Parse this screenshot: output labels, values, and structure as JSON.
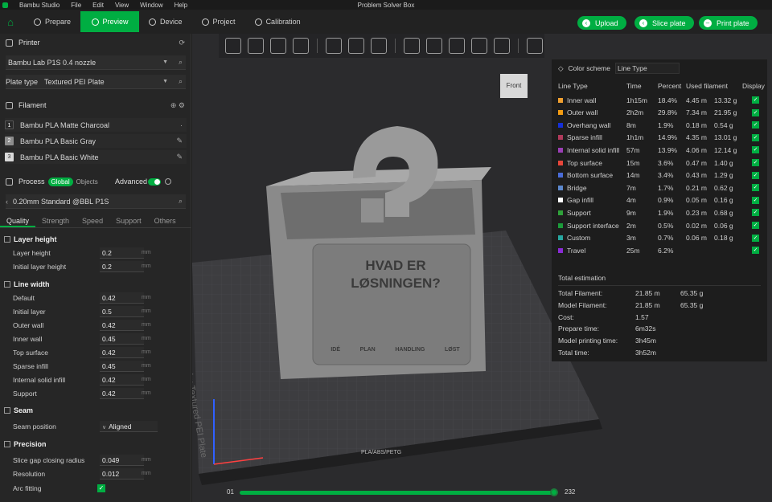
{
  "app": {
    "name": "Bambu Studio",
    "window_title": "Problem Solver Box",
    "menu": [
      "File",
      "Edit",
      "View",
      "Window",
      "Help"
    ]
  },
  "toolbar": {
    "tabs": [
      "Prepare",
      "Preview",
      "Device",
      "Project",
      "Calibration"
    ],
    "active_tab": "Preview",
    "actions": [
      "Upload",
      "Slice plate",
      "Print plate"
    ]
  },
  "printer": {
    "section": "Printer",
    "name": "Bambu Lab P1S 0.4 nozzle",
    "plate_label": "Plate type",
    "plate_value": "Textured PEI Plate"
  },
  "filament": {
    "section": "Filament",
    "items": [
      {
        "num": "1",
        "name": "Bambu PLA Matte Charcoal",
        "color": "#2a2a2a"
      },
      {
        "num": "2",
        "name": "Bambu PLA Basic Gray",
        "color": "#8c8c8c"
      },
      {
        "num": "3",
        "name": "Bambu PLA Basic White",
        "color": "#d9d9d9"
      }
    ]
  },
  "process": {
    "section": "Process",
    "global": "Global",
    "objects": "Objects",
    "advanced": "Advanced",
    "advanced_on": true,
    "preset": "0.20mm Standard @BBL P1S",
    "tabs": [
      "Quality",
      "Strength",
      "Speed",
      "Support",
      "Others"
    ],
    "active": "Quality"
  },
  "settings": {
    "layer_height": {
      "title": "Layer height",
      "params": [
        {
          "label": "Layer height",
          "value": "0.2",
          "unit": "mm"
        },
        {
          "label": "Initial layer height",
          "value": "0.2",
          "unit": "mm"
        }
      ]
    },
    "line_width": {
      "title": "Line width",
      "params": [
        {
          "label": "Default",
          "value": "0.42",
          "unit": "mm"
        },
        {
          "label": "Initial layer",
          "value": "0.5",
          "unit": "mm"
        },
        {
          "label": "Outer wall",
          "value": "0.42",
          "unit": "mm"
        },
        {
          "label": "Inner wall",
          "value": "0.45",
          "unit": "mm"
        },
        {
          "label": "Top surface",
          "value": "0.42",
          "unit": "mm"
        },
        {
          "label": "Sparse infill",
          "value": "0.45",
          "unit": "mm"
        },
        {
          "label": "Internal solid infill",
          "value": "0.42",
          "unit": "mm"
        },
        {
          "label": "Support",
          "value": "0.42",
          "unit": "mm"
        }
      ]
    },
    "seam": {
      "title": "Seam",
      "params": [
        {
          "label": "Seam position",
          "value": "Aligned"
        }
      ]
    },
    "precision": {
      "title": "Precision",
      "params": [
        {
          "label": "Slice gap closing radius",
          "value": "0.049",
          "unit": "mm"
        },
        {
          "label": "Resolution",
          "value": "0.012",
          "unit": "mm"
        },
        {
          "label": "Arc fitting",
          "checked": true
        }
      ]
    }
  },
  "viewport": {
    "cube_label": "Front",
    "plate_text": "Bambu Textured PEI Plate",
    "plate_tag": "PLA/ABS/PETG",
    "model_text": [
      "HVAD ER",
      "LØSNINGEN?"
    ],
    "model_icons": [
      "IDÉ",
      "PLAN",
      "HANDLING",
      "LØST"
    ]
  },
  "legend": {
    "color_scheme_label": "Color scheme",
    "color_scheme": "Line Type",
    "headers": [
      "Line Type",
      "Time",
      "Percent",
      "Used filament",
      "Display"
    ],
    "rows": [
      {
        "type": "Inner wall",
        "time": "1h15m",
        "percent": "18.4%",
        "len": "4.45 m",
        "weight": "13.32 g",
        "color": "#f0a030"
      },
      {
        "type": "Outer wall",
        "time": "2h2m",
        "percent": "29.8%",
        "len": "7.34 m",
        "weight": "21.95 g",
        "color": "#f39c12"
      },
      {
        "type": "Overhang wall",
        "time": "8m",
        "percent": "1.9%",
        "len": "0.18 m",
        "weight": "0.54 g",
        "color": "#1530d8"
      },
      {
        "type": "Sparse infill",
        "time": "1h1m",
        "percent": "14.9%",
        "len": "4.35 m",
        "weight": "13.01 g",
        "color": "#b03a5b"
      },
      {
        "type": "Internal solid infill",
        "time": "57m",
        "percent": "13.9%",
        "len": "4.06 m",
        "weight": "12.14 g",
        "color": "#9b3fb6"
      },
      {
        "type": "Top surface",
        "time": "15m",
        "percent": "3.6%",
        "len": "0.47 m",
        "weight": "1.40 g",
        "color": "#e8463a"
      },
      {
        "type": "Bottom surface",
        "time": "14m",
        "percent": "3.4%",
        "len": "0.43 m",
        "weight": "1.29 g",
        "color": "#4a6cd8"
      },
      {
        "type": "Bridge",
        "time": "7m",
        "percent": "1.7%",
        "len": "0.21 m",
        "weight": "0.62 g",
        "color": "#5c88cc"
      },
      {
        "type": "Gap infill",
        "time": "4m",
        "percent": "0.9%",
        "len": "0.05 m",
        "weight": "0.16 g",
        "color": "#ffffff"
      },
      {
        "type": "Support",
        "time": "9m",
        "percent": "1.9%",
        "len": "0.23 m",
        "weight": "0.68 g",
        "color": "#2fa23a"
      },
      {
        "type": "Support interface",
        "time": "2m",
        "percent": "0.5%",
        "len": "0.02 m",
        "weight": "0.06 g",
        "color": "#1b9b3a"
      },
      {
        "type": "Custom",
        "time": "3m",
        "percent": "0.7%",
        "len": "0.06 m",
        "weight": "0.18 g",
        "color": "#27a7a0"
      },
      {
        "type": "Travel",
        "time": "25m",
        "percent": "6.2%",
        "len": "",
        "weight": "",
        "color": "#8a2bd6"
      }
    ],
    "total_title": "Total estimation",
    "totals": [
      {
        "k": "Total Filament:",
        "a": "21.85 m",
        "b": "65.35 g"
      },
      {
        "k": "Model Filament:",
        "a": "21.85 m",
        "b": "65.35 g"
      },
      {
        "k": "Cost:",
        "a": "1.57",
        "b": ""
      },
      {
        "k": "Prepare time:",
        "a": "6m32s",
        "b": ""
      },
      {
        "k": "Model printing time:",
        "a": "3h45m",
        "b": ""
      },
      {
        "k": "Total time:",
        "a": "3h52m",
        "b": ""
      }
    ]
  },
  "layer_slider": {
    "min": "01",
    "max": "232"
  }
}
